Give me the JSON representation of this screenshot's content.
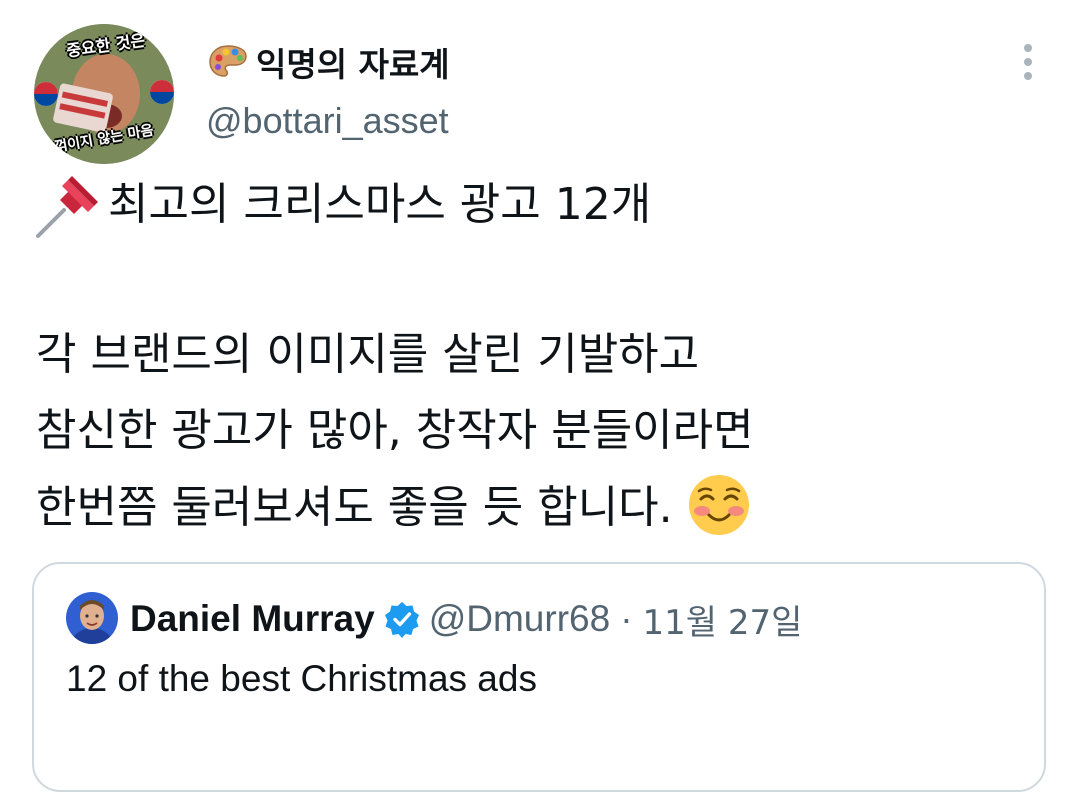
{
  "tweet": {
    "author": {
      "display_name": "익명의 자료계",
      "handle": "@bottari_asset",
      "avatar_caption_top": "중요한 것은",
      "avatar_caption_bottom": "꺾이지 않는 마음",
      "name_icon": "artist-palette-icon"
    },
    "headline_icon": "pushpin-icon",
    "headline": "최고의 크리스마스 광고 12개",
    "body_lines": [
      "각 브랜드의 이미지를 살린 기발하고",
      "참신한 광고가 많아, 창작자 분들이라면",
      "한번쯤 둘러보셔도 좋을 듯 합니다."
    ],
    "body_emoji": "smiling-face-icon",
    "more_icon": "more-vertical-icon"
  },
  "quote": {
    "display_name": "Daniel Murray",
    "verified_icon": "verified-badge-icon",
    "handle": "@Dmurr68",
    "separator": "·",
    "date": "11월 27일",
    "text": "12 of the best Christmas ads"
  },
  "colors": {
    "text_primary": "#0f1419",
    "text_secondary": "#536471",
    "border": "#cfd9de",
    "verified_blue": "#1d9bf0",
    "pin_red": "#d9304a"
  }
}
